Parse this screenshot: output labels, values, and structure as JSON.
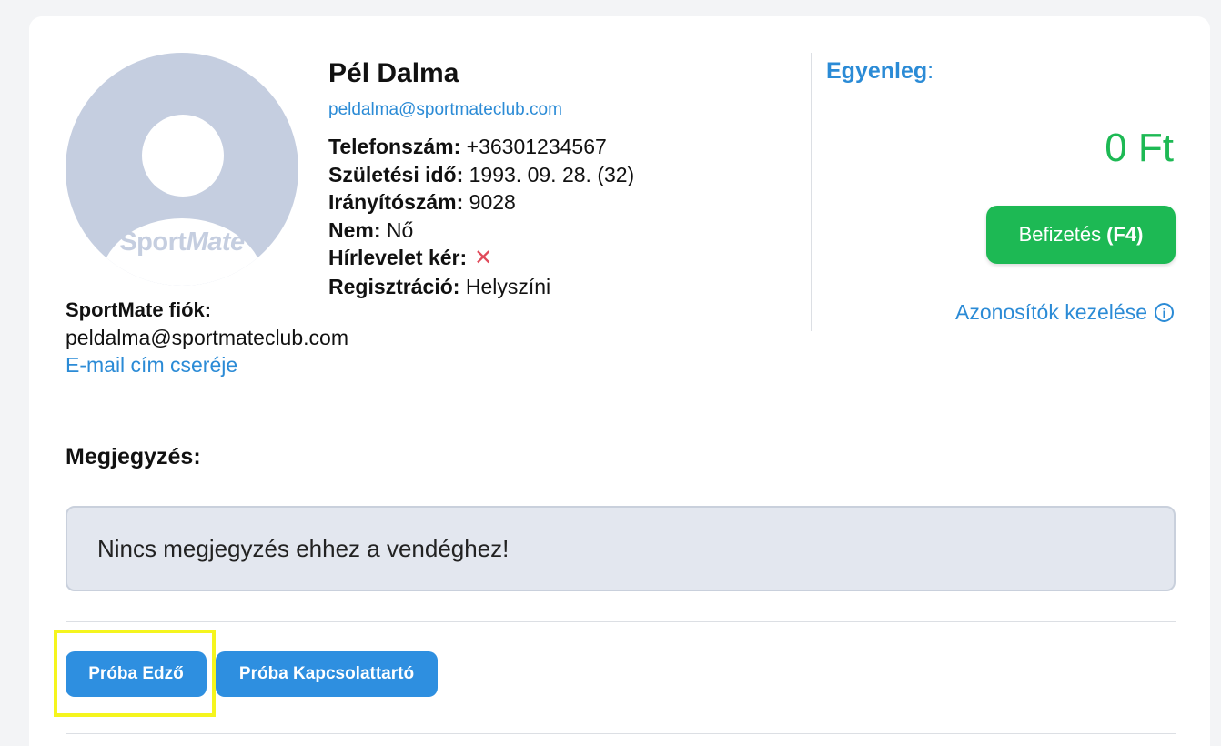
{
  "profile": {
    "avatar_brand_sport": "Sport",
    "avatar_brand_mate": "Mate",
    "name": "Pél Dalma",
    "email": "peldalma@sportmateclub.com",
    "fields": [
      {
        "label": "Telefonszám:",
        "value": "+36301234567"
      },
      {
        "label": "Születési idő:",
        "value": "1993. 09. 28. (32)"
      },
      {
        "label": "Irányítószám:",
        "value": "9028"
      },
      {
        "label": "Nem:",
        "value": "Nő"
      },
      {
        "label": "Hírlevelet kér:",
        "value": "✕"
      },
      {
        "label": "Regisztráció:",
        "value": "Helyszíni"
      }
    ]
  },
  "account": {
    "label": "SportMate fiók:",
    "email": "peldalma@sportmateclub.com",
    "change_email_link": "E-mail cím cseréje"
  },
  "balance": {
    "label": "Egyenleg",
    "colon": ":",
    "amount": "0 Ft",
    "pay_label": "Befizetés",
    "pay_shortcut": "(F4)",
    "manage_ids_link": "Azonosítók kezelése",
    "info_icon": "i"
  },
  "notes": {
    "label": "Megjegyzés:",
    "text": "Nincs megjegyzés ehhez a vendéghez!"
  },
  "roles": [
    {
      "label": "Próba Edző"
    },
    {
      "label": "Próba Kapcsolattartó"
    }
  ],
  "colors": {
    "accent_blue": "#2b8bd6",
    "success_green": "#1db954",
    "danger_red": "#e04a5a",
    "highlight_yellow": "#f5f51e"
  }
}
